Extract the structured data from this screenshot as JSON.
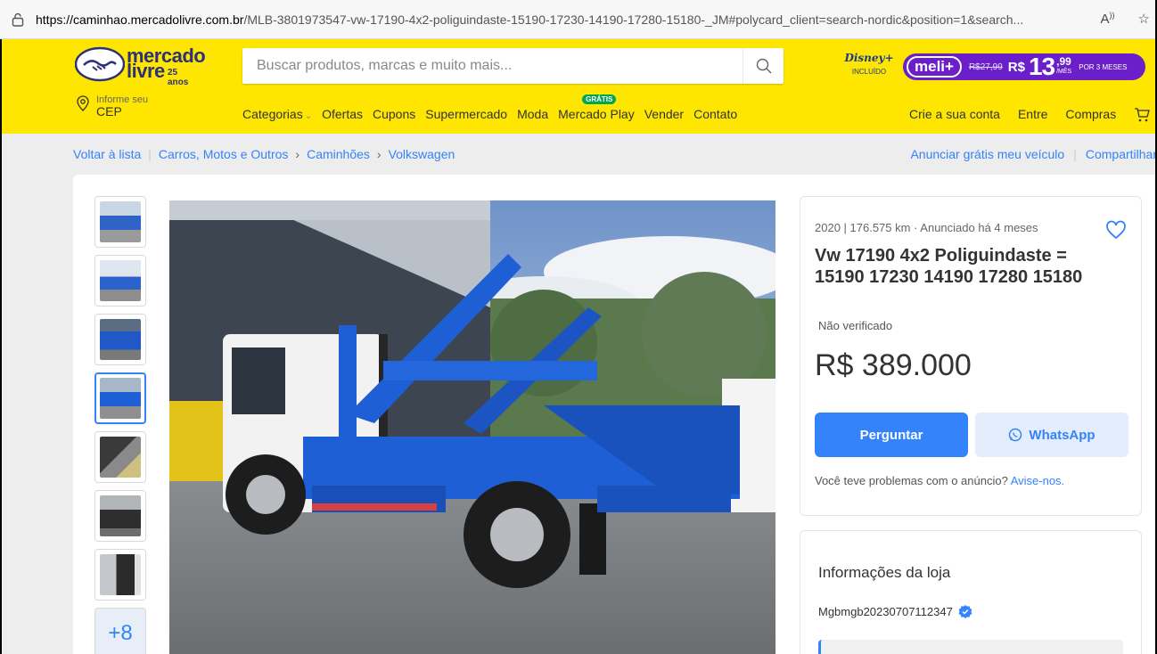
{
  "browser": {
    "url_host": "https://caminhao.mercadolivre.com.br",
    "url_path": "/MLB-3801973547-vw-17190-4x2-poliguindaste-15190-17230-14190-17280-15180-_JM#polycard_client=search-nordic&position=1&search..."
  },
  "header": {
    "logo_line1": "mercado",
    "logo_line2": "livre",
    "logo_years": "25 anos",
    "search_placeholder": "Buscar produtos, marcas e muito mais...",
    "cep_label": "Informe seu",
    "cep_value": "CEP",
    "promo": {
      "disney": "Disney+",
      "disney_sub": "INCLUÍDO",
      "meli_label": "meli+",
      "old_price": "R$27,99",
      "currency": "R$",
      "price_int": "13",
      "price_cents": ",99",
      "per_month": "/MÊS",
      "period": "POR 3 MESES"
    },
    "nav": [
      {
        "label": "Categorias"
      },
      {
        "label": "Ofertas"
      },
      {
        "label": "Cupons"
      },
      {
        "label": "Supermercado"
      },
      {
        "label": "Moda"
      },
      {
        "label": "Mercado Play",
        "badge": "GRÁTIS"
      },
      {
        "label": "Vender"
      },
      {
        "label": "Contato"
      }
    ],
    "account": [
      "Crie a sua conta",
      "Entre",
      "Compras"
    ]
  },
  "breadcrumb": {
    "back": "Voltar à lista",
    "items": [
      "Carros, Motos e Outros",
      "Caminhões",
      "Volkswagen"
    ],
    "right_links": [
      "Anunciar grátis meu veículo",
      "Compartilhar"
    ]
  },
  "gallery": {
    "more_count": "+8",
    "active_index": 3
  },
  "product": {
    "subtitle": "2020 | 176.575 km · Anunciado há 4 meses",
    "title": "Vw 17190 4x2 Poliguindaste = 15190 17230 14190 17280 15180",
    "verified": "Não verificado",
    "price": "R$ 389.000",
    "ask_button": "Perguntar",
    "whatsapp_button": "WhatsApp",
    "problem_text": "Você teve problemas com o anúncio?",
    "problem_link": "Avise-nos."
  },
  "store": {
    "title": "Informações da loja",
    "name": "Mgbmgb20230707112347"
  },
  "colors": {
    "brand_yellow": "#ffe600",
    "accent_blue": "#3483fa",
    "meli_purple": "#6a1fc8",
    "truck_blue": "#1f5fd6"
  }
}
